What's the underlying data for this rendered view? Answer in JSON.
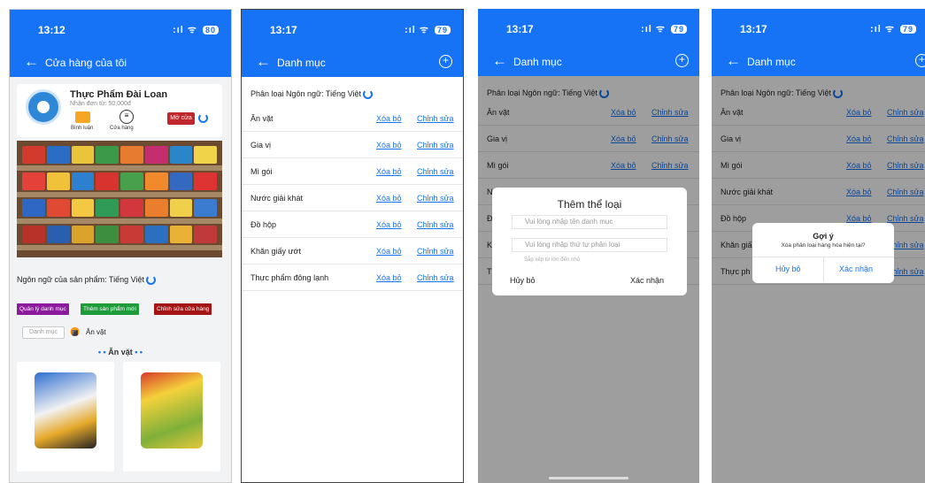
{
  "colors": {
    "primary": "#1673f5",
    "danger": "#c0262d",
    "manage": "#8b1a9c",
    "add": "#1e9b3a",
    "edit": "#a31414"
  },
  "screen1": {
    "time": "13:12",
    "battery": "80",
    "nav_title": "Cửa hàng của tôi",
    "store_name": "Thực Phẩm Đài Loan",
    "min_order": "Nhận đơn từ: 50,000đ",
    "review_label": "Bình luận",
    "store_label": "Cửa hàng",
    "open_label": "Mở cửa",
    "product_lang": "Ngôn ngữ của sản phẩm: Tiếng Việt",
    "btn_manage": "Quản lý danh mục",
    "btn_add": "Thêm sản phẩm mới",
    "btn_edit_store": "Chỉnh sửa cửa hàng",
    "category_field": "Danh mục",
    "selected_category": "Ăn vặt",
    "section_title": "Ăn vặt",
    "section_dots": "• •"
  },
  "screen2": {
    "time": "13:17",
    "battery": "79",
    "nav_title": "Danh mục",
    "lang_line": "Phân loại Ngôn ngữ: Tiếng Việt",
    "delete_label": "Xóa bỏ",
    "edit_label": "Chỉnh sửa",
    "categories": [
      "Ăn vặt",
      "Gia vị",
      "Mì gói",
      "Nước giải khát",
      "Đồ hộp",
      "Khăn giấy ướt",
      "Thực phẩm đông lạnh"
    ]
  },
  "screen3": {
    "time": "13:17",
    "battery": "79",
    "nav_title": "Danh mục",
    "lang_line": "Phân loại Ngôn ngữ: Tiếng Việt",
    "delete_label": "Xóa bỏ",
    "edit_label": "Chỉnh sửa",
    "categories": [
      "Ăn vặt",
      "Gia vị",
      "Mì gói"
    ],
    "hidden_initials": [
      "N",
      "Đ",
      "K",
      "T"
    ],
    "dialog": {
      "title": "Thêm thể loại",
      "name_placeholder": "Vui lòng nhập tên danh mục",
      "order_placeholder": "Vui lòng nhập thứ tự phân loại",
      "order_hint": "Sắp xếp từ lớn đến nhỏ",
      "cancel": "Hủy bỏ",
      "confirm": "Xác nhận"
    }
  },
  "screen4": {
    "time": "13:17",
    "battery": "79",
    "nav_title": "Danh mục",
    "lang_line": "Phân loại Ngôn ngữ: Tiếng Việt",
    "delete_label": "Xóa bỏ",
    "edit_label": "Chỉnh sửa",
    "categories": [
      "Ăn vặt",
      "Gia vị",
      "Mì gói",
      "Nước giải khát",
      "Đồ hộp"
    ],
    "partial_rows": [
      "Khăn giấ",
      "Thực ph"
    ],
    "alert": {
      "title": "Gợi ý",
      "message": "Xóa phân loại hàng hóa hiện tại?",
      "cancel": "Hủy bỏ",
      "confirm": "Xác nhận"
    }
  }
}
